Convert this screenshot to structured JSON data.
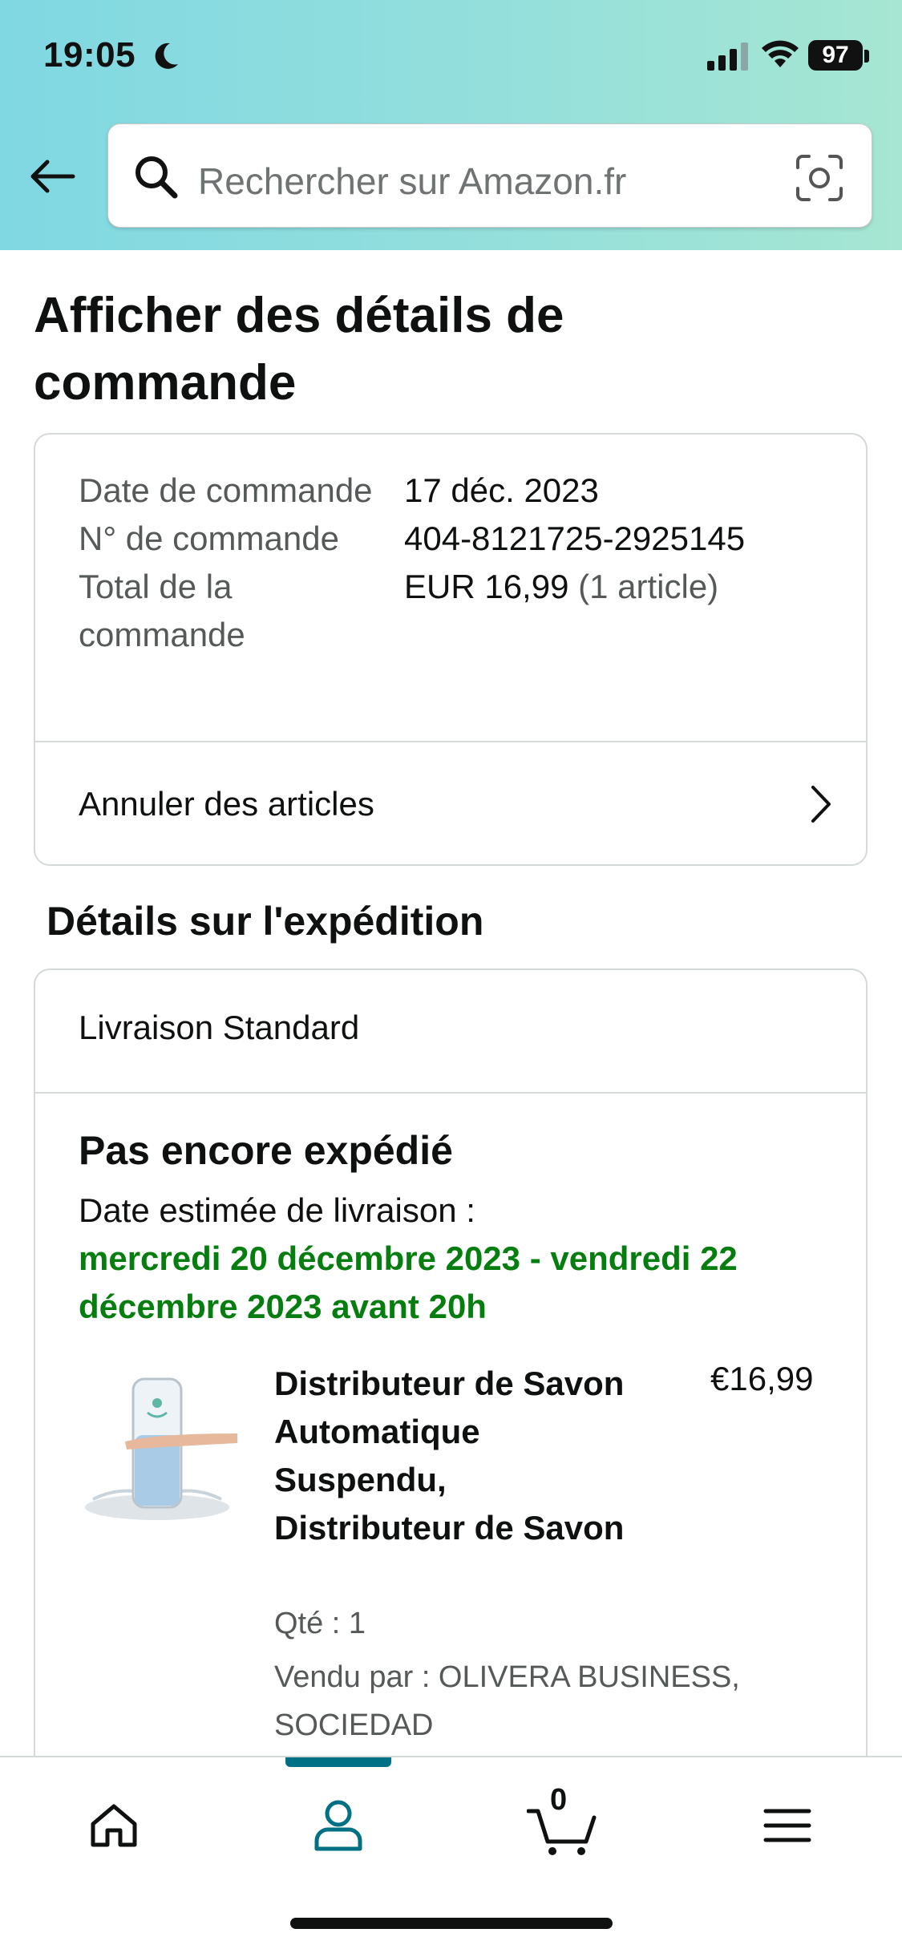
{
  "status_bar": {
    "time": "19:05",
    "battery": "97"
  },
  "search": {
    "placeholder": "Rechercher sur Amazon.fr"
  },
  "page": {
    "title": "Afficher des détails de commande"
  },
  "order_summary": {
    "rows": [
      {
        "label": "Date de commande",
        "value": "17 déc. 2023"
      },
      {
        "label": "N° de commande",
        "value": "404-8121725-2925145"
      },
      {
        "label": "Total de la commande",
        "value": "EUR 16,99",
        "extra": "(1 article)"
      }
    ],
    "cancel_label": "Annuler des articles"
  },
  "shipment": {
    "section_title": "Détails sur l'expédition",
    "method": "Livraison Standard",
    "status": "Pas encore expédié",
    "estimate_label": "Date estimée de livraison :",
    "estimate_date": "mercredi 20 décembre 2023 - vendredi 22 décembre 2023 avant 20h",
    "product": {
      "title": "Distributeur de Savon Automatique Suspendu, Distributeur de Savon",
      "price": "€16,99",
      "quantity": "Qté : 1",
      "seller": "Vendu par : OLIVERA BUSINESS, SOCIEDAD"
    }
  },
  "tab_bar": {
    "active": "account",
    "cart_count": "0",
    "accent_color": "#007185"
  },
  "colors": {
    "delivery_green": "#067d0f",
    "header_gradient_start": "#80d8e2",
    "header_gradient_end": "#a6e6d2"
  }
}
